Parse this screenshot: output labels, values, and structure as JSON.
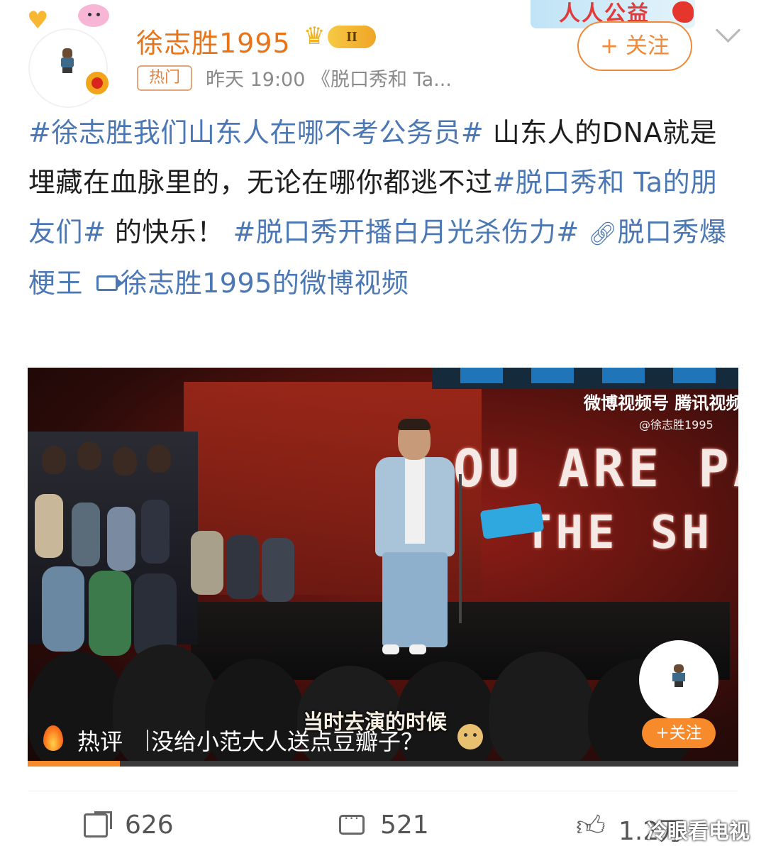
{
  "header": {
    "username": "徐志胜1995",
    "level_badge": "II",
    "hot_tag": "热门",
    "timestamp": "昨天 19:00",
    "source": "《脱口秀和 Ta...",
    "follow_label": "+ 关注",
    "promo_banner": "人人公益"
  },
  "post": {
    "topic1": "#徐志胜我们山东人在哪不考公务员#",
    "text1": " 山东人的DNA就是埋藏在血脉里的，无论在哪你都逃不过",
    "topic2": "#脱口秀和 Ta的朋友们#",
    "text2": " 的快乐！",
    "topic3": "#脱口秀开播白月光杀伤力#",
    "link_label": "脱口秀爆梗王",
    "video_link": "徐志胜1995的微博视频"
  },
  "video": {
    "watermark_logo": "微博视频号 腾讯视频",
    "watermark_user": "@徐志胜1995",
    "stage_text_line1": "OU ARE PA",
    "stage_text_line2": "THE SH",
    "subtitle": "当时去演的时候",
    "hot_comment_label": "热评",
    "hot_comment_text": "没给小范大人送点豆瓣子？",
    "follow_label": "+关注",
    "progress": 0.13
  },
  "actions": {
    "share_count": "626",
    "comment_count": "521",
    "like_count": "1.2万"
  },
  "site_watermark": "冷眼看电视",
  "colors": {
    "username": "#e8741a",
    "topic": "#4b78b5",
    "accent": "#f78a2a"
  },
  "icons": [
    "heart-icon",
    "verified-icon",
    "crown-icon",
    "chevron-down-icon",
    "link-icon",
    "video-icon",
    "flame-icon",
    "doge-icon",
    "share-icon",
    "comment-icon",
    "like-icon"
  ]
}
